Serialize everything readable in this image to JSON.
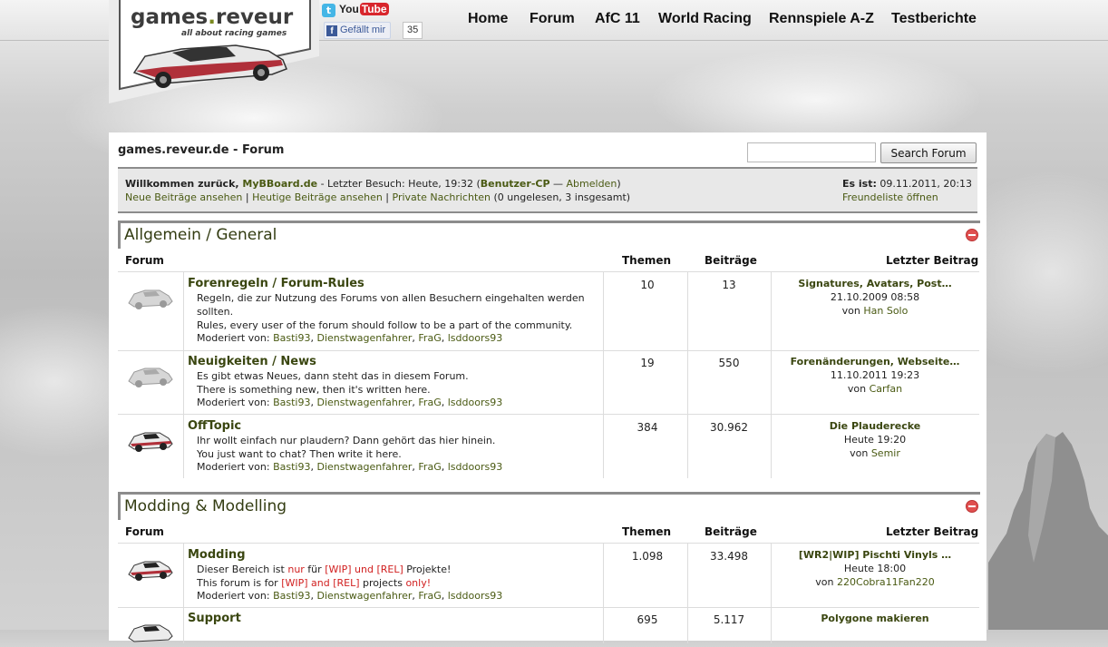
{
  "logo": {
    "main": "games",
    "dot": ".",
    "rest": "reveur",
    "tagline": "all about racing games"
  },
  "social": {
    "twitter": "t",
    "youtube_you": "You",
    "youtube_tube": "Tube",
    "fb_f": "f",
    "fb_like": "Gefällt mir",
    "fb_count": "35"
  },
  "nav": [
    "Home",
    "Forum",
    "AfC 11",
    "World Racing",
    "Rennspiele A-Z",
    "Testberichte"
  ],
  "page_title": "games.reveur.de - Forum",
  "search": {
    "button": "Search Forum",
    "value": ""
  },
  "welcome": {
    "prefix": "Willkommen zurück, ",
    "user": "MyBBoard.de",
    "last_visit": " - Letzter Besuch: Heute, 19:32 (",
    "cp": "Benutzer-CP",
    "dash": " — ",
    "logout": "Abmelden",
    "close": ")",
    "new_posts": "Neue Beiträge ansehen",
    "sep": " | ",
    "today_posts": "Heutige Beiträge ansehen",
    "pm": "Private Nachrichten",
    "pm_count": " (0 ungelesen, 3 insgesamt)",
    "date_label": "Es ist:",
    "date_value": " 09.11.2011, 20:13",
    "buddylist": "Freundeliste öffnen"
  },
  "columns": {
    "forum": "Forum",
    "threads": "Themen",
    "posts": "Beiträge",
    "last": "Letzter Beitrag"
  },
  "categories": [
    {
      "title": "Allgemein / General",
      "forums": [
        {
          "name": "Forenregeln / Forum-Rules",
          "desc": [
            "Regeln, die zur Nutzung des Forums von allen Besuchern eingehalten werden",
            "sollten.",
            "Rules, every user of the forum should follow to be a part of the community."
          ],
          "mod_label": "Moderiert von: ",
          "mods": [
            "Basti93",
            "Dienstwagenfahrer",
            "FraG",
            "lsddoors93"
          ],
          "threads": "10",
          "posts": "13",
          "last_title": "Signatures, Avatars, Post…",
          "last_date": "21.10.2009 08:58",
          "last_by": "von ",
          "last_user": "Han Solo"
        },
        {
          "name": "Neuigkeiten / News",
          "desc": [
            "Es gibt etwas Neues, dann steht das in diesem Forum.",
            "There is something new, then it's written here."
          ],
          "mod_label": "Moderiert von: ",
          "mods": [
            "Basti93",
            "Dienstwagenfahrer",
            "FraG",
            "lsddoors93"
          ],
          "threads": "19",
          "posts": "550",
          "last_title": "Forenänderungen, Webseite…",
          "last_date": "11.10.2011 19:23",
          "last_by": "von ",
          "last_user": "Carfan"
        },
        {
          "name": "OffTopic",
          "desc": [
            "Ihr wollt einfach nur plaudern? Dann gehört das hier hinein.",
            "You just want to chat? Then write it here."
          ],
          "mod_label": "Moderiert von: ",
          "mods": [
            "Basti93",
            "Dienstwagenfahrer",
            "FraG",
            "lsddoors93"
          ],
          "threads": "384",
          "posts": "30.962",
          "last_title": "Die Plauderecke",
          "last_date": "Heute 19:20",
          "last_by": "von ",
          "last_user": "Semir"
        }
      ]
    },
    {
      "title": "Modding & Modelling",
      "forums": [
        {
          "name": "Modding",
          "desc1": {
            "a": "Dieser Bereich ist ",
            "b": "nur",
            "c": " für ",
            "d": "[WIP] und [REL]",
            "e": " Projekte!"
          },
          "desc2": {
            "a": "This forum is for ",
            "b": "[WIP] and [REL]",
            "c": " projects ",
            "d": "only!"
          },
          "mod_label": "Moderiert von: ",
          "mods": [
            "Basti93",
            "Dienstwagenfahrer",
            "FraG",
            "lsddoors93"
          ],
          "threads": "1.098",
          "posts": "33.498",
          "last_title": "[WR2|WIP] Pischti Vinyls …",
          "last_date": "Heute 18:00",
          "last_by": "von ",
          "last_user": "220Cobra11Fan220"
        },
        {
          "name": "Support",
          "threads": "695",
          "posts": "5.117",
          "last_title": "Polygone makieren"
        }
      ]
    }
  ],
  "mod_sep": ", "
}
